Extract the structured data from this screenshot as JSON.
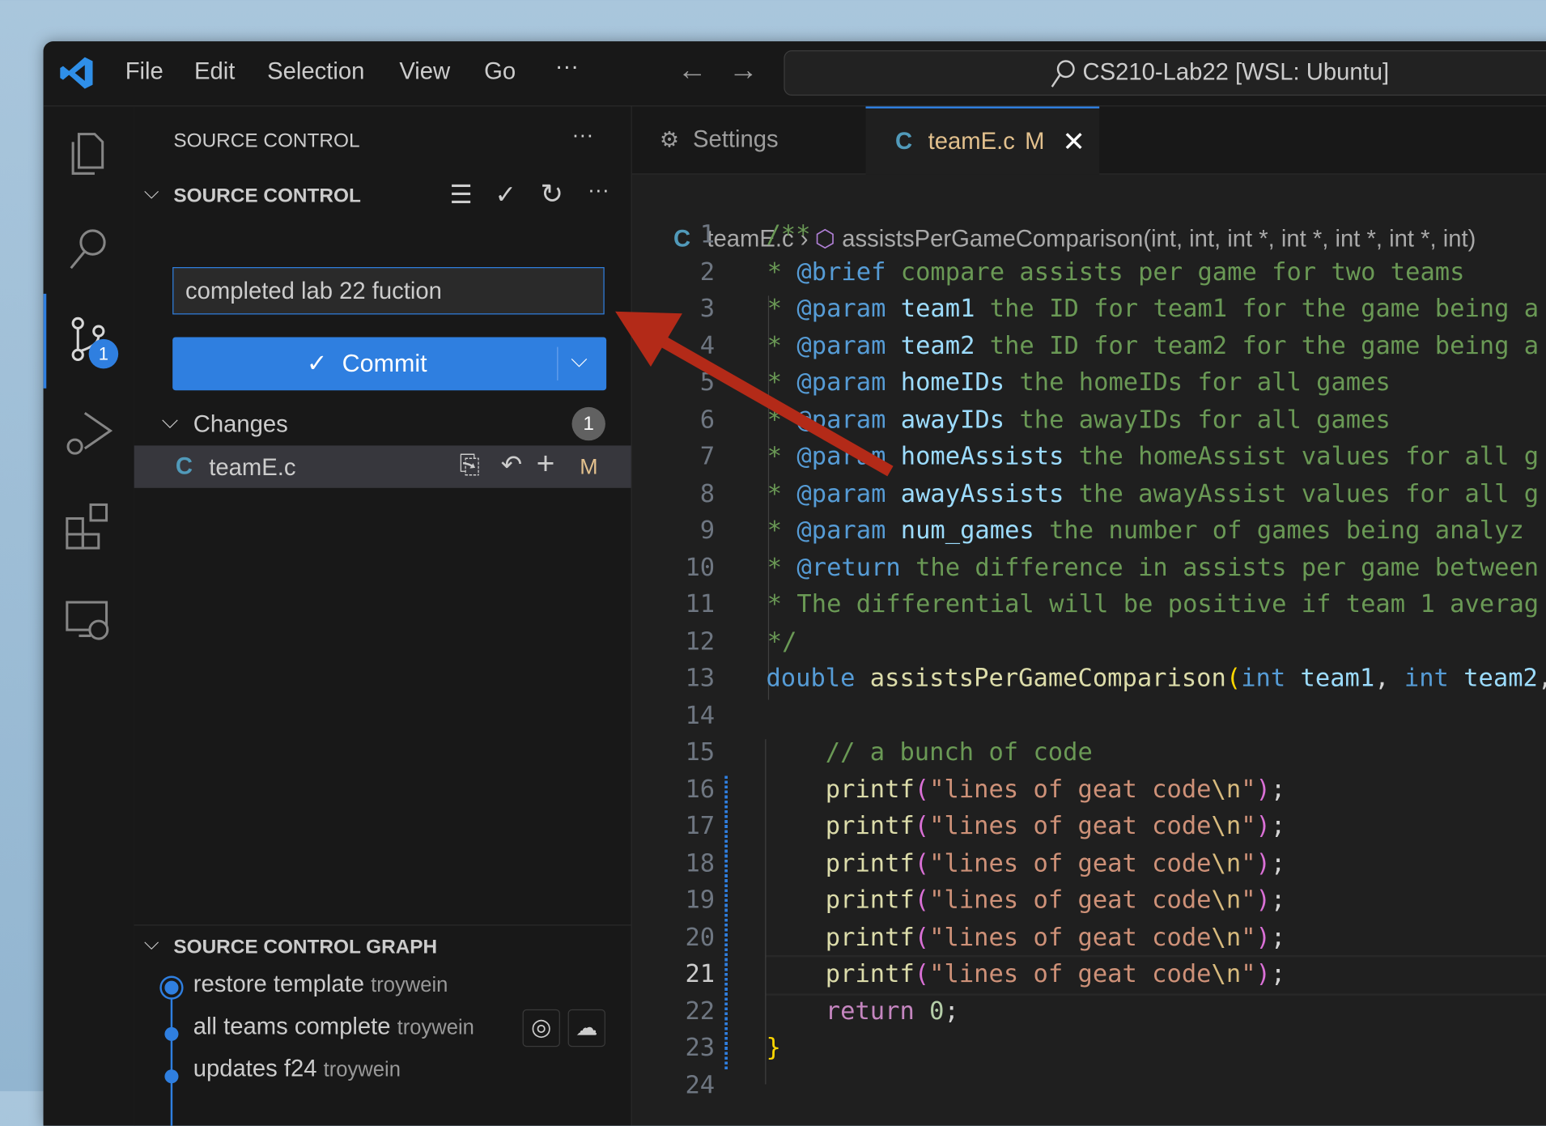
{
  "titlebar": {
    "menu": [
      "File",
      "Edit",
      "Selection",
      "View",
      "Go",
      "···"
    ],
    "command_center": "CS210-Lab22 [WSL: Ubuntu]"
  },
  "activity": {
    "scm_badge": "1"
  },
  "sidebar": {
    "title": "SOURCE CONTROL",
    "more": "···",
    "section": "SOURCE CONTROL",
    "commit_message": "completed lab 22 fuction",
    "commit_label": "Commit",
    "changes_label": "Changes",
    "changes_count": "1",
    "file": {
      "icon": "C",
      "name": "teamE.c",
      "status": "M"
    },
    "graph": {
      "title": "SOURCE CONTROL GRAPH",
      "commits": [
        {
          "message": "restore template",
          "author": "troywein"
        },
        {
          "message": "all teams complete",
          "author": "troywein"
        },
        {
          "message": "updates f24",
          "author": "troywein"
        }
      ]
    }
  },
  "editor": {
    "tabs": [
      {
        "label": "Settings"
      },
      {
        "icon": "C",
        "label": "teamE.c",
        "status": "M"
      }
    ],
    "breadcrumb": {
      "file": "teamE.c",
      "symbol": "assistsPerGameComparison(int, int, int *, int *, int *, int *, int)"
    },
    "current_line": 21,
    "lines": [
      [
        [
          "/**",
          "c"
        ]
      ],
      [
        [
          " * ",
          "c"
        ],
        [
          "@brief",
          "t"
        ],
        [
          " compare assists per game for two teams",
          "c"
        ]
      ],
      [
        [
          " * ",
          "c"
        ],
        [
          "@param",
          "t"
        ],
        [
          " team1",
          "p"
        ],
        [
          " the ID for team1 for the game being a",
          "c"
        ]
      ],
      [
        [
          " * ",
          "c"
        ],
        [
          "@param",
          "t"
        ],
        [
          " team2",
          "p"
        ],
        [
          " the ID for team2 for the game being a",
          "c"
        ]
      ],
      [
        [
          " * ",
          "c"
        ],
        [
          "@param",
          "t"
        ],
        [
          " homeIDs",
          "p"
        ],
        [
          " the homeIDs for all games",
          "c"
        ]
      ],
      [
        [
          " * ",
          "c"
        ],
        [
          "@param",
          "t"
        ],
        [
          " awayIDs",
          "p"
        ],
        [
          " the awayIDs for all games",
          "c"
        ]
      ],
      [
        [
          " * ",
          "c"
        ],
        [
          "@param",
          "t"
        ],
        [
          " homeAssists",
          "p"
        ],
        [
          " the homeAssist values for all g",
          "c"
        ]
      ],
      [
        [
          " * ",
          "c"
        ],
        [
          "@param",
          "t"
        ],
        [
          " awayAssists",
          "p"
        ],
        [
          " the awayAssist values for all g",
          "c"
        ]
      ],
      [
        [
          " * ",
          "c"
        ],
        [
          "@param",
          "t"
        ],
        [
          " num_games",
          "p"
        ],
        [
          " the number of games being analyz",
          "c"
        ]
      ],
      [
        [
          " * ",
          "c"
        ],
        [
          "@return",
          "t"
        ],
        [
          " the difference in assists per game between",
          "c"
        ]
      ],
      [
        [
          " * The differential will be positive if team 1 averag",
          "c"
        ]
      ],
      [
        [
          " */",
          "c"
        ]
      ],
      [
        [
          "double",
          "k"
        ],
        [
          " assistsPerGameComparison",
          "f"
        ],
        [
          "(",
          "y"
        ],
        [
          "int",
          "k"
        ],
        [
          " team1",
          "p"
        ],
        [
          ", ",
          "d"
        ],
        [
          "int",
          "k"
        ],
        [
          " team2",
          "p"
        ],
        [
          ",",
          "d"
        ]
      ],
      [],
      [
        [
          "    // a bunch of code",
          "c"
        ]
      ],
      [
        [
          "    printf",
          "f"
        ],
        [
          "(",
          "pp"
        ],
        [
          "\"lines of geat code",
          "s"
        ],
        [
          "\\n",
          "e"
        ],
        [
          "\"",
          "s"
        ],
        [
          ")",
          "pp"
        ],
        [
          ";",
          "d"
        ]
      ],
      [
        [
          "    printf",
          "f"
        ],
        [
          "(",
          "pp"
        ],
        [
          "\"lines of geat code",
          "s"
        ],
        [
          "\\n",
          "e"
        ],
        [
          "\"",
          "s"
        ],
        [
          ")",
          "pp"
        ],
        [
          ";",
          "d"
        ]
      ],
      [
        [
          "    printf",
          "f"
        ],
        [
          "(",
          "pp"
        ],
        [
          "\"lines of geat code",
          "s"
        ],
        [
          "\\n",
          "e"
        ],
        [
          "\"",
          "s"
        ],
        [
          ")",
          "pp"
        ],
        [
          ";",
          "d"
        ]
      ],
      [
        [
          "    printf",
          "f"
        ],
        [
          "(",
          "pp"
        ],
        [
          "\"lines of geat code",
          "s"
        ],
        [
          "\\n",
          "e"
        ],
        [
          "\"",
          "s"
        ],
        [
          ")",
          "pp"
        ],
        [
          ";",
          "d"
        ]
      ],
      [
        [
          "    printf",
          "f"
        ],
        [
          "(",
          "pp"
        ],
        [
          "\"lines of geat code",
          "s"
        ],
        [
          "\\n",
          "e"
        ],
        [
          "\"",
          "s"
        ],
        [
          ")",
          "pp"
        ],
        [
          ";",
          "d"
        ]
      ],
      [
        [
          "    printf",
          "f"
        ],
        [
          "(",
          "pp"
        ],
        [
          "\"lines of geat code",
          "s"
        ],
        [
          "\\n",
          "e"
        ],
        [
          "\"",
          "s"
        ],
        [
          ")",
          "pp"
        ],
        [
          ";",
          "d"
        ]
      ],
      [
        [
          "    return",
          "r"
        ],
        [
          " 0",
          "n"
        ],
        [
          ";",
          "d"
        ]
      ],
      [
        [
          "}",
          "y"
        ]
      ],
      []
    ]
  },
  "colors": {
    "accent": "#2f7fe0",
    "annotation_arrow": "#b32a18",
    "modified": "#e2c08d"
  }
}
